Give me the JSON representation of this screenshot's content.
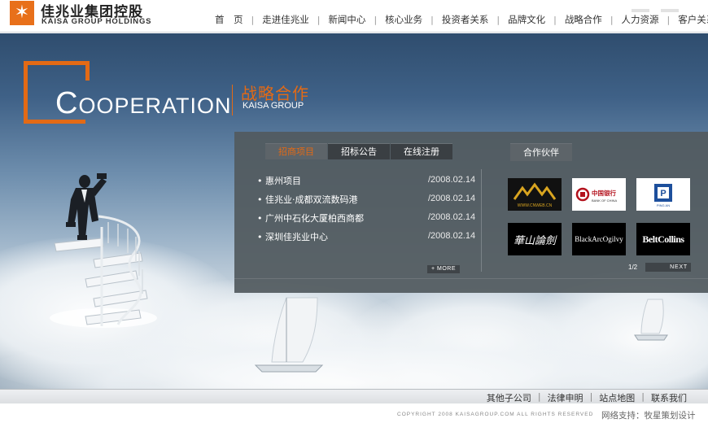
{
  "brand": {
    "name_cn": "佳兆业集团控股",
    "name_en": "KAISA GROUP HOLDINGS",
    "accent": "#e36a15"
  },
  "nav": {
    "items": [
      "首　页",
      "走进佳兆业",
      "新闻中心",
      "核心业务",
      "投资者关系",
      "品牌文化",
      "战略合作",
      "人力资源",
      "客户关系"
    ]
  },
  "hero": {
    "title_big": "C",
    "title_rest": "OOPERATION",
    "title_cn": "战略合作",
    "subtitle_en": "KAISA GROUP"
  },
  "panel": {
    "tabs": [
      "招商项目",
      "招标公告",
      "在线注册"
    ],
    "partner_tab": "合作伙伴",
    "list": [
      {
        "title": "惠州项目",
        "date": "/2008.02.14"
      },
      {
        "title": "佳兆业·成都双流数码港",
        "date": "/2008.02.14"
      },
      {
        "title": "广州中石化大厦柏西商都",
        "date": "/2008.02.14"
      },
      {
        "title": "深圳佳兆业中心",
        "date": "/2008.02.14"
      }
    ],
    "more_label": "+ MORE",
    "pager": "1/2",
    "next_label": "NEXT",
    "partners": [
      {
        "name": "WWW.CNWEB.CN",
        "bg": "#111111",
        "fg": "#d9a520"
      },
      {
        "name": "中国银行 BANK OF CHINA",
        "bg": "#ffffff",
        "fg": "#b3121d"
      },
      {
        "name": "PING AN",
        "bg": "#ffffff",
        "fg": "#1d4f9c"
      },
      {
        "name": "華山論劍",
        "bg": "#000000",
        "fg": "#ffffff"
      },
      {
        "name": "BlackArcOgilvy",
        "bg": "#000000",
        "fg": "#ffffff"
      },
      {
        "name": "BeltCollins",
        "bg": "#000000",
        "fg": "#ffffff"
      }
    ]
  },
  "footer": {
    "links": [
      "其他子公司",
      "法律申明",
      "站点地图",
      "联系我们"
    ],
    "copyright": "COPYRIGHT 2008 KAISAGROUP.COM ALL RIGHTS RESERVED",
    "support": "网络支持：牧星策划设计"
  }
}
